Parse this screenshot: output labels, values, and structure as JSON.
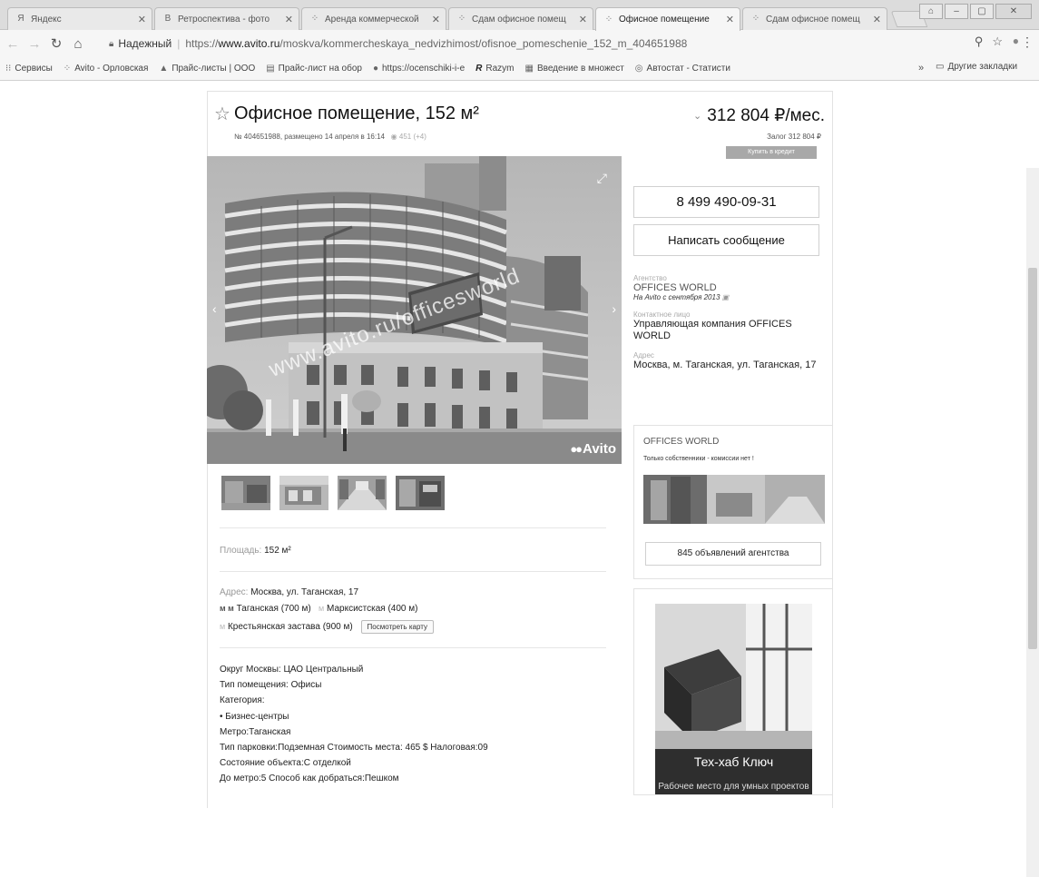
{
  "browser": {
    "tabs": [
      {
        "label": "Яндекс",
        "icon": "yandex-icon",
        "glyph": "Я"
      },
      {
        "label": "Ретроспектива - фото",
        "icon": "vc-icon",
        "glyph": "B"
      },
      {
        "label": "Аренда коммерческой",
        "icon": "avito-icon",
        "glyph": "⁘"
      },
      {
        "label": "Сдам офисное помещ",
        "icon": "avito-icon",
        "glyph": "⁘"
      },
      {
        "label": "Офисное помещение",
        "icon": "avito-icon",
        "glyph": "⁘",
        "active": true
      },
      {
        "label": "Сдам офисное помещ",
        "icon": "avito-icon",
        "glyph": "⁘"
      }
    ],
    "address": {
      "secure_label": "Надежный",
      "url_prefix": "https://",
      "url_host": "www.avito.ru",
      "url_path": "/moskva/kommercheskaya_nedvizhimost/ofisnoe_pomeschenie_152_m_404651988"
    },
    "bookmarks": [
      {
        "label": "Сервисы",
        "icon": "apps-icon"
      },
      {
        "label": "Avito - Орловская",
        "icon": "avito-icon"
      },
      {
        "label": "Прайс-листы | ООО",
        "icon": "building-icon"
      },
      {
        "label": "Прайс-лист на обор",
        "icon": "doc-icon"
      },
      {
        "label": "https://ocenschiki-i-e",
        "icon": "circle-icon"
      },
      {
        "label": "Razym",
        "icon": "r-icon"
      },
      {
        "label": "Введение в множест",
        "icon": "grid-icon"
      },
      {
        "label": "Автостат - Статисти",
        "icon": "car-icon"
      }
    ],
    "bookmarks_more": "»",
    "other_bookmarks": "Другие закладки"
  },
  "listing": {
    "title": "Офисное помещение, 152 м²",
    "meta_text": "№ 404651988, размещено 14 апреля в 16:14",
    "views": "451 (+4)",
    "price": "312 804 ₽/мес.",
    "deposit": "Залог 312 804 ₽",
    "credit_button": "Купить в кредит",
    "watermark": "www.avito.ru/officesworld",
    "photo_logo": "Avito",
    "area_label": "Площадь:",
    "area_value": "152 м²",
    "address_label": "Адрес:",
    "address_value": "Москва, ул. Таганская, 17",
    "metro_1": "Таганская (700 м)",
    "metro_2": "Марксистская (400 м)",
    "metro_3": "Крестьянская застава (900 м)",
    "map_button": "Посмотреть карту",
    "details": [
      "Округ Москвы: ЦАО Центральный",
      "Тип помещения: Офисы",
      "Категория:",
      "• Бизнес-центры",
      "Метро:Таганская",
      "Тип парковки:Подземная Стоимость места: 465 $ Налоговая:09",
      "Состояние объекта:С отделкой",
      "До метро:5 Способ как добраться:Пешком"
    ]
  },
  "seller": {
    "phone": "8 499 490-09-31",
    "message_button": "Написать сообщение",
    "agency_label": "Агентство",
    "agency_name": "OFFICES WORLD",
    "since": "На Avito с сентября 2013",
    "contact_label": "Контактное лицо",
    "contact_name": "Управляющая компания OFFICES WORLD",
    "address_label": "Адрес",
    "address_value": "Москва, м. Таганская, ул. Таганская, 17"
  },
  "agency_card": {
    "name": "OFFICES WORLD",
    "tagline": "Только собственники - комиссии нет !",
    "count_button": "845 объявлений агентства"
  },
  "ad": {
    "title": "Тех-хаб Ключ",
    "subtitle": "Рабочее место для умных проектов"
  }
}
